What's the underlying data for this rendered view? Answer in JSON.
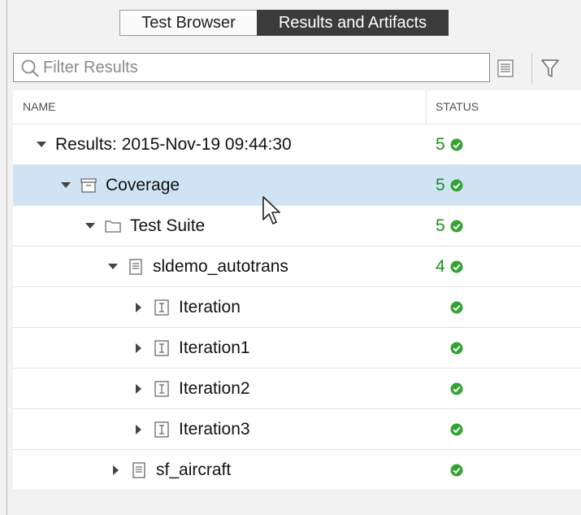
{
  "tabs": [
    {
      "label": "Test Browser",
      "active": false
    },
    {
      "label": "Results and Artifacts",
      "active": true
    }
  ],
  "filter": {
    "placeholder": "Filter Results",
    "value": ""
  },
  "table": {
    "headers": {
      "name": "NAME",
      "status": "STATUS"
    },
    "rows": [
      {
        "label": "Results: 2015-Nov-19 09:44:30",
        "count": "5",
        "level": 0,
        "expanded": true,
        "icon": "none"
      },
      {
        "label": "Coverage",
        "count": "5",
        "level": 1,
        "expanded": true,
        "icon": "archive-icon",
        "selected": true
      },
      {
        "label": "Test Suite",
        "count": "5",
        "level": 2,
        "expanded": true,
        "icon": "folder-icon"
      },
      {
        "label": "sldemo_autotrans",
        "count": "4",
        "level": 3,
        "expanded": true,
        "icon": "document-icon"
      },
      {
        "label": "Iteration",
        "count": "",
        "level": 4,
        "expanded": false,
        "icon": "iteration-icon"
      },
      {
        "label": "Iteration1",
        "count": "",
        "level": 4,
        "expanded": false,
        "icon": "iteration-icon"
      },
      {
        "label": "Iteration2",
        "count": "",
        "level": 4,
        "expanded": false,
        "icon": "iteration-icon"
      },
      {
        "label": "Iteration3",
        "count": "",
        "level": 4,
        "expanded": false,
        "icon": "iteration-icon"
      },
      {
        "label": "sf_aircraft",
        "count": "",
        "level": 3,
        "expanded": false,
        "icon": "document-icon"
      }
    ]
  },
  "colors": {
    "selected_row": "#cfe3f5",
    "pass_green": "#33a333",
    "count_green": "#1e8e1e",
    "active_tab": "#3b3b3b"
  }
}
